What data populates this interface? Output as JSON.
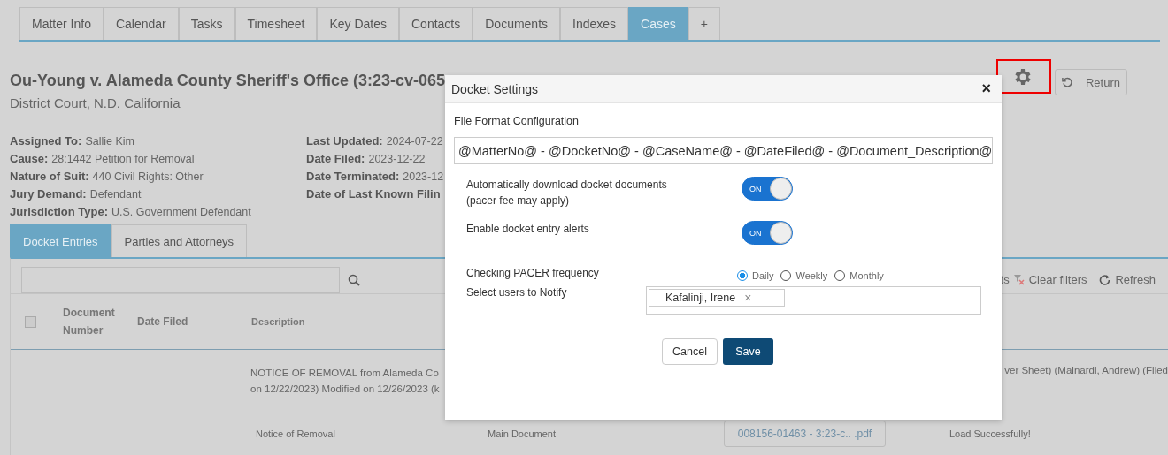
{
  "tabs": [
    {
      "label": "Matter Info",
      "selected": false
    },
    {
      "label": "Calendar",
      "selected": false
    },
    {
      "label": "Tasks",
      "selected": false
    },
    {
      "label": "Timesheet",
      "selected": false
    },
    {
      "label": "Key Dates",
      "selected": false
    },
    {
      "label": "Contacts",
      "selected": false
    },
    {
      "label": "Documents",
      "selected": false
    },
    {
      "label": "Indexes",
      "selected": false
    },
    {
      "label": "Cases",
      "selected": true
    },
    {
      "label": "+",
      "selected": false
    }
  ],
  "case": {
    "title": "Ou-Young v. Alameda County Sheriff's Office (3:23-cv-065",
    "court": "District Court, N.D. California"
  },
  "header_buttons": {
    "return": "Return"
  },
  "details_left": [
    {
      "label": "Assigned To:",
      "value": "Sallie Kim"
    },
    {
      "label": "Cause:",
      "value": "28:1442 Petition for Removal"
    },
    {
      "label": "Nature of Suit:",
      "value": "440 Civil Rights: Other"
    },
    {
      "label": "Jury Demand:",
      "value": "Defendant"
    },
    {
      "label": "Jurisdiction Type:",
      "value": "U.S. Government Defendant"
    }
  ],
  "details_right": [
    {
      "label": "Last Updated:",
      "value": "2024-07-22"
    },
    {
      "label": "Date Filed:",
      "value": "2023-12-22"
    },
    {
      "label": "Date Terminated:",
      "value": "2023-12"
    },
    {
      "label": "Date of Last Known Filin"
    }
  ],
  "sub_tabs": [
    {
      "label": "Docket Entries",
      "selected": true
    },
    {
      "label": "Parties and Attorneys",
      "selected": false
    }
  ],
  "toolbar": {
    "partial": "ts",
    "clear_filters": "Clear filters",
    "refresh": "Refresh"
  },
  "table": {
    "select_all_checked": false,
    "columns": [
      "Document Number",
      "Date Filed",
      "Description"
    ],
    "entry": {
      "description_lines": [
        "NOTICE OF REMOVAL from Alameda Co",
        "on 12/22/2023) Modified on 12/26/2023 (k"
      ],
      "description_tail": "ver Sheet) (Mainardi, Andrew) (Filed",
      "attachment_name": "Notice of Removal",
      "attachment_type": "Main Document",
      "file": "008156-01463 - 3:23-c.. .pdf",
      "status": "Load Successfully!"
    }
  },
  "dialog": {
    "title": "Docket Settings",
    "format_label": "File Format Configuration",
    "format_value": "@MatterNo@ - @DocketNo@ - @CaseName@ - @DateFiled@ - @Document_Description@",
    "toggles": [
      {
        "label_lines": [
          "Automatically download docket documents",
          "(pacer fee may apply)"
        ],
        "on": true,
        "text": "ON"
      },
      {
        "label_lines": [
          "Enable docket entry alerts"
        ],
        "on": true,
        "text": "ON"
      }
    ],
    "frequency_label": "Checking PACER frequency",
    "frequency_options": [
      {
        "label": "Daily",
        "selected": true
      },
      {
        "label": "Weekly",
        "selected": false
      },
      {
        "label": "Monthly",
        "selected": false
      }
    ],
    "notify_label": "Select users to Notify",
    "notify_users": [
      "Kafalinji, Irene"
    ],
    "remove_mark": "×",
    "close_mark": "×",
    "cancel": "Cancel",
    "save": "Save"
  }
}
